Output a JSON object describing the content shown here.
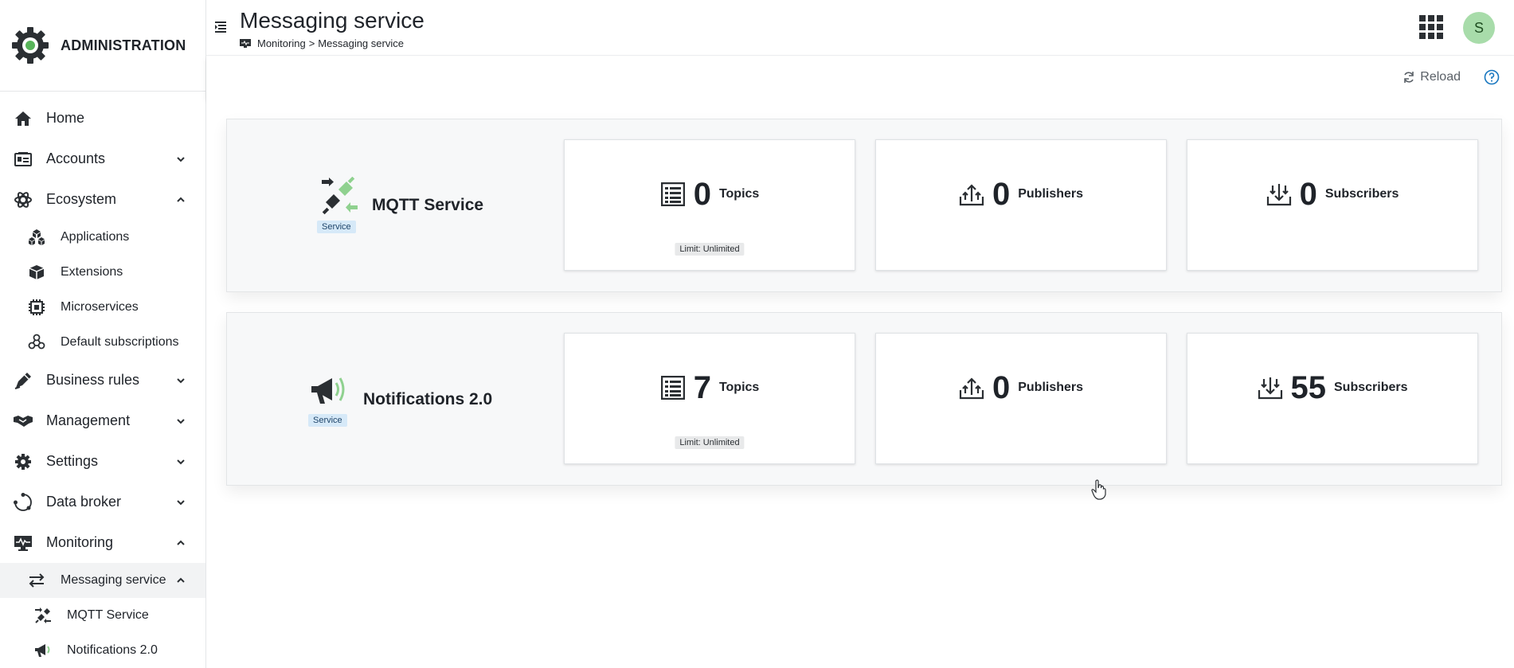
{
  "sidebar": {
    "brand": "ADMINISTRATION",
    "items": [
      {
        "label": "Home",
        "icon": "home-icon"
      },
      {
        "label": "Accounts",
        "icon": "accounts-icon"
      },
      {
        "label": "Ecosystem",
        "icon": "ecosystem-icon"
      },
      {
        "label": "Applications",
        "icon": "applications-icon"
      },
      {
        "label": "Extensions",
        "icon": "extensions-icon"
      },
      {
        "label": "Microservices",
        "icon": "microservices-icon"
      },
      {
        "label": "Default subscriptions",
        "icon": "default-subscriptions-icon"
      },
      {
        "label": "Business rules",
        "icon": "business-rules-icon"
      },
      {
        "label": "Management",
        "icon": "management-icon"
      },
      {
        "label": "Settings",
        "icon": "gear-icon"
      },
      {
        "label": "Data broker",
        "icon": "data-broker-icon"
      },
      {
        "label": "Monitoring",
        "icon": "monitoring-icon"
      },
      {
        "label": "Messaging service",
        "icon": "messaging-service-icon"
      },
      {
        "label": "MQTT Service",
        "icon": "mqtt-plug-icon"
      },
      {
        "label": "Notifications 2.0",
        "icon": "megaphone-icon"
      }
    ]
  },
  "header": {
    "title": "Messaging service",
    "breadcrumb": [
      "Monitoring",
      ">",
      "Messaging service"
    ],
    "avatar_initial": "S"
  },
  "actions": {
    "reload_label": "Reload"
  },
  "services": [
    {
      "name": "MQTT Service",
      "badge": "Service",
      "topics": {
        "value": "0",
        "label": "Topics",
        "limit": "Limit: Unlimited"
      },
      "publishers": {
        "value": "0",
        "label": "Publishers"
      },
      "subscribers": {
        "value": "0",
        "label": "Subscribers"
      }
    },
    {
      "name": "Notifications 2.0",
      "badge": "Service",
      "topics": {
        "value": "7",
        "label": "Topics",
        "limit": "Limit: Unlimited"
      },
      "publishers": {
        "value": "0",
        "label": "Publishers"
      },
      "subscribers": {
        "value": "55",
        "label": "Subscribers"
      }
    }
  ],
  "colors": {
    "accent_green": "#8fd18f",
    "avatar_bg": "#a8dcaa",
    "badge_blue": "#d6e9f8",
    "link_blue": "#1776bf"
  }
}
